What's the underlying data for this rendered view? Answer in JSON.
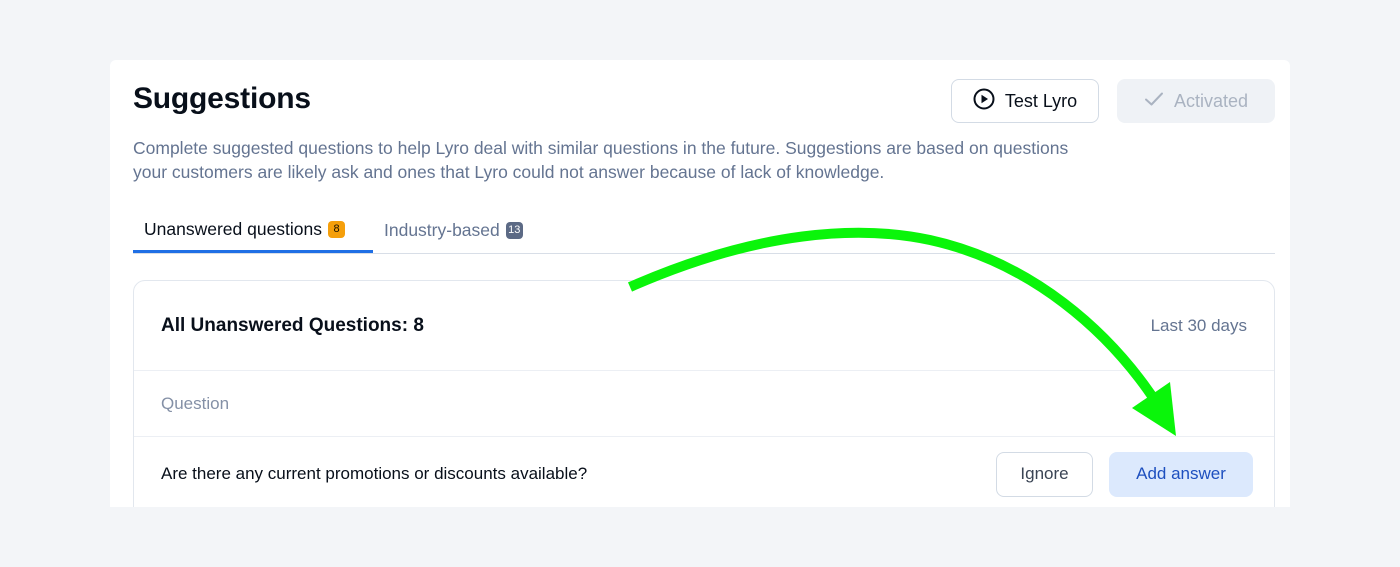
{
  "header": {
    "title": "Suggestions",
    "description": "Complete suggested questions to help Lyro deal with similar questions in the future. Suggestions are based on questions your customers are likely ask and ones that Lyro could not answer because of lack of knowledge.",
    "test_button": {
      "label": "Test Lyro",
      "icon": "play-circle-icon"
    },
    "activated_button": {
      "label": "Activated",
      "icon": "check-icon"
    }
  },
  "tabs": [
    {
      "label": "Unanswered questions",
      "count": "8",
      "active": true,
      "badge_color": "#f59f0b"
    },
    {
      "label": "Industry-based",
      "count": "13",
      "active": false,
      "badge_color": "#5c6a85"
    }
  ],
  "card": {
    "title": "All Unanswered Questions: 8",
    "range": "Last 30 days",
    "column_header": "Question",
    "rows": [
      {
        "question": "Are there any current promotions or discounts available?",
        "ignore_label": "Ignore",
        "add_label": "Add answer"
      }
    ]
  },
  "annotation": {
    "type": "arrow",
    "color": "#00ff00",
    "points_to": "Add answer"
  },
  "colors": {
    "accent": "#1f6fe5",
    "background": "#f3f5f8"
  }
}
